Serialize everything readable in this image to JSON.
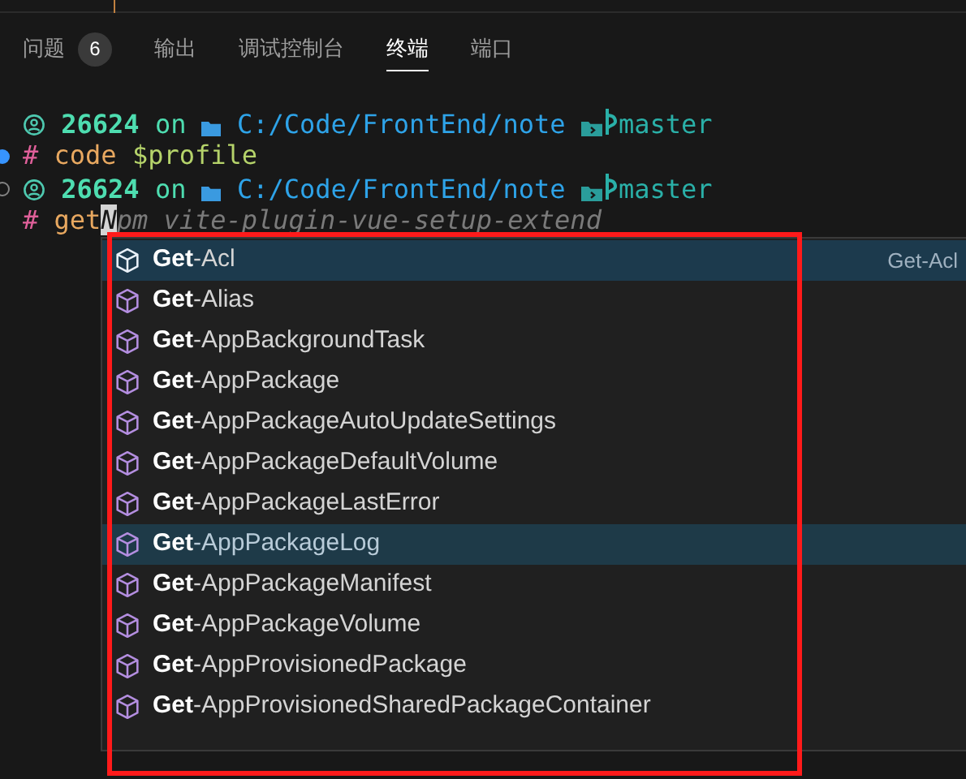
{
  "panel_tabs": [
    {
      "label": "问题",
      "badge": "6",
      "selected": false
    },
    {
      "label": "输出",
      "selected": false
    },
    {
      "label": "调试控制台",
      "selected": false
    },
    {
      "label": "终端",
      "selected": true
    },
    {
      "label": "端口",
      "selected": false
    }
  ],
  "terminal": {
    "lines": [
      {
        "kind": "prompt",
        "user": "26624",
        "on": "on",
        "path": "C:/Code/FrontEnd/note",
        "branch": "master"
      },
      {
        "kind": "command",
        "succeeded": true,
        "hash": "#",
        "command": "code",
        "argument": "$profile"
      },
      {
        "kind": "prompt",
        "succeeded": false,
        "user": "26624",
        "on": "on",
        "path": "C:/Code/FrontEnd/note",
        "branch": "master"
      },
      {
        "kind": "input",
        "hash": "#",
        "typed": "get",
        "cursor_char": "N",
        "suggestion": "pm vite-plugin-vue-setup-extend"
      }
    ]
  },
  "suggestions": {
    "items": [
      {
        "label": "**Get**-Acl",
        "selected": true,
        "hovered": false,
        "detail": "Get-Acl"
      },
      {
        "label": "**Get**-Alias",
        "selected": false,
        "hovered": false
      },
      {
        "label": "**Get**-AppBackgroundTask",
        "selected": false,
        "hovered": false
      },
      {
        "label": "**Get**-AppPackage",
        "selected": false,
        "hovered": false
      },
      {
        "label": "**Get**-AppPackageAutoUpdateSettings",
        "selected": false,
        "hovered": false
      },
      {
        "label": "**Get**-AppPackageDefaultVolume",
        "selected": false,
        "hovered": false
      },
      {
        "label": "**Get**-AppPackageLastError",
        "selected": false,
        "hovered": false
      },
      {
        "label": "**Get**-AppPackageLog",
        "selected": false,
        "hovered": true
      },
      {
        "label": "**Get**-AppPackageManifest",
        "selected": false,
        "hovered": false
      },
      {
        "label": "**Get**-AppPackageVolume",
        "selected": false,
        "hovered": false
      },
      {
        "label": "**Get**-AppProvisionedPackage",
        "selected": false,
        "hovered": false
      },
      {
        "label": "**Get**-AppProvisionedSharedPackageContainer",
        "selected": false,
        "hovered": false
      }
    ]
  }
}
